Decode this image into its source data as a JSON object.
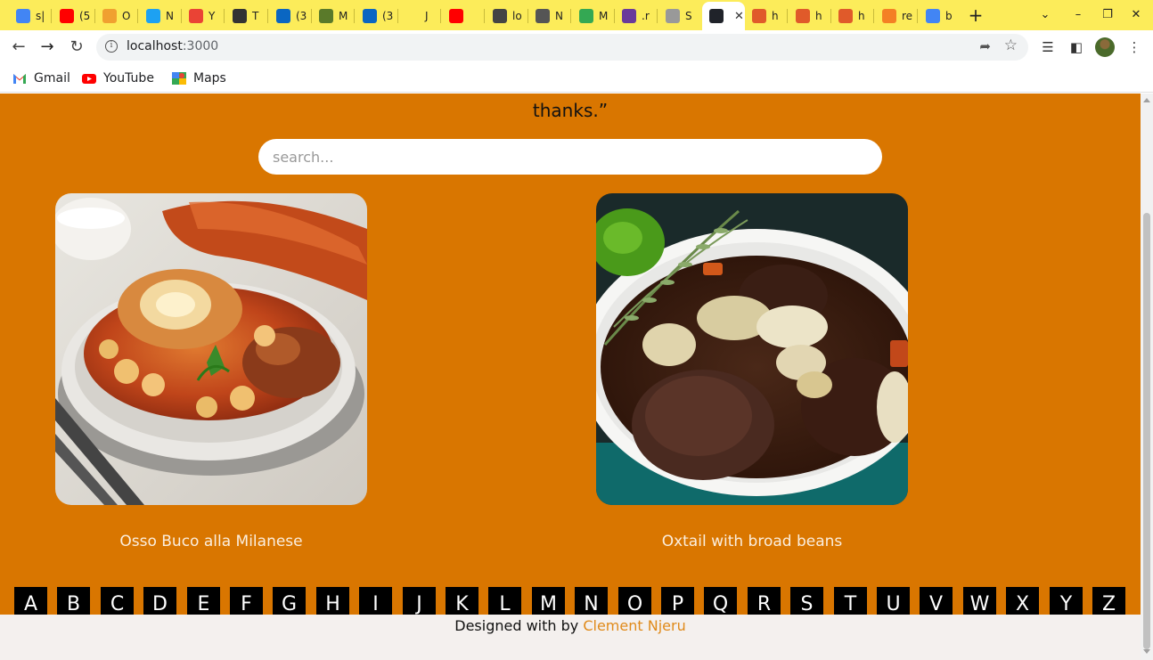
{
  "browser": {
    "tabs": [
      {
        "label": "s|",
        "color": "#4285f4"
      },
      {
        "label": "(5",
        "color": "#ff0000"
      },
      {
        "label": "O",
        "color": "#f0a030"
      },
      {
        "label": "N",
        "color": "#1da1f2"
      },
      {
        "label": "Y",
        "color": "#ea4335"
      },
      {
        "label": "T",
        "color": "#333333"
      },
      {
        "label": "(3",
        "color": "#0a66c2"
      },
      {
        "label": "M",
        "color": "#5a7a2a"
      },
      {
        "label": "(3",
        "color": "#0a66c2"
      },
      {
        "label": "J",
        "color": "#fcec5a"
      },
      {
        "label": "",
        "color": "#ff0000"
      },
      {
        "label": "lo",
        "color": "#444444"
      },
      {
        "label": "N",
        "color": "#555555"
      },
      {
        "label": "M",
        "color": "#34a853"
      },
      {
        "label": ".r",
        "color": "#6a3a9a"
      },
      {
        "label": "S",
        "color": "#999999"
      },
      {
        "label": "",
        "color": "#20232a"
      },
      {
        "label": "h",
        "color": "#e05a2a"
      },
      {
        "label": "h",
        "color": "#e05a2a"
      },
      {
        "label": "h",
        "color": "#e05a2a"
      },
      {
        "label": "re",
        "color": "#f48024"
      },
      {
        "label": "b",
        "color": "#4285f4"
      }
    ],
    "active_tab_close": "✕",
    "new_tab": "+",
    "url_host": "localhost",
    "url_port": ":3000",
    "bookmarks": [
      {
        "label": "Gmail",
        "color": "#ea4335"
      },
      {
        "label": "YouTube",
        "color": "#ff0000"
      },
      {
        "label": "Maps",
        "color": "#34a853"
      }
    ]
  },
  "page": {
    "quote_end": "thanks.”",
    "search_placeholder": "search...",
    "meals": [
      {
        "title": "Osso Buco alla Milanese"
      },
      {
        "title": "Oxtail with broad beans"
      }
    ],
    "letters": [
      "A",
      "B",
      "C",
      "D",
      "E",
      "F",
      "G",
      "H",
      "I",
      "J",
      "K",
      "L",
      "M",
      "N",
      "O",
      "P",
      "Q",
      "R",
      "S",
      "T",
      "U",
      "V",
      "W",
      "X",
      "Y",
      "Z"
    ],
    "footer_prefix": "Designed with by",
    "footer_author": "Clement Njeru"
  }
}
